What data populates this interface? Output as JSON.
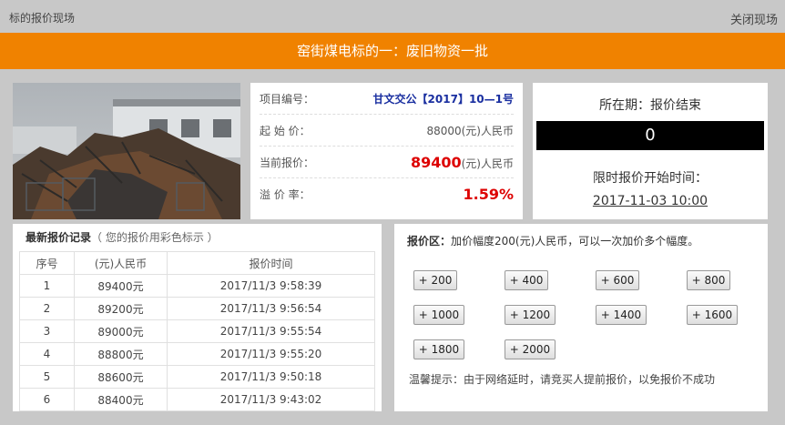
{
  "top": {
    "breadcrumb": "标的报价现场",
    "close_label": "关闭现场"
  },
  "banner": {
    "title": "窑街煤电标的一：废旧物资一批"
  },
  "info": {
    "project_label": "项目编号：",
    "project_value": "甘文交公【2017】10—1号",
    "start_label": "起 始 价：",
    "start_value": "88000(元)人民币",
    "current_label": "当前报价：",
    "current_value": "89400",
    "current_unit": "(元)人民币",
    "premium_label": "溢 价 率：",
    "premium_value": "1.59%"
  },
  "status": {
    "period": "所在期：报价结束",
    "counter": "0",
    "start_time_label": "限时报价开始时间：",
    "start_time": "2017-11-03 10:00"
  },
  "records": {
    "title": "最新报价记录",
    "subtitle": "（ 您的报价用彩色标示 ）",
    "columns": [
      "序号",
      "(元)人民币",
      "报价时间"
    ],
    "rows": [
      [
        "1",
        "89400元",
        "2017/11/3 9:58:39"
      ],
      [
        "2",
        "89200元",
        "2017/11/3 9:56:54"
      ],
      [
        "3",
        "89000元",
        "2017/11/3 9:55:54"
      ],
      [
        "4",
        "88800元",
        "2017/11/3 9:55:20"
      ],
      [
        "5",
        "88600元",
        "2017/11/3 9:50:18"
      ],
      [
        "6",
        "88400元",
        "2017/11/3 9:43:02"
      ]
    ]
  },
  "bid": {
    "title": "报价区：",
    "desc": "加价幅度200(元)人民币，可以一次加价多个幅度。",
    "buttons": [
      "+ 200",
      "+ 400",
      "+ 600",
      "+ 800",
      "+ 1000",
      "+ 1200",
      "+ 1400",
      "+ 1600",
      "+ 1800",
      "+ 2000"
    ],
    "tip": "温馨提示：由于网络延时，请竞买人提前报价，以免报价不成功"
  }
}
